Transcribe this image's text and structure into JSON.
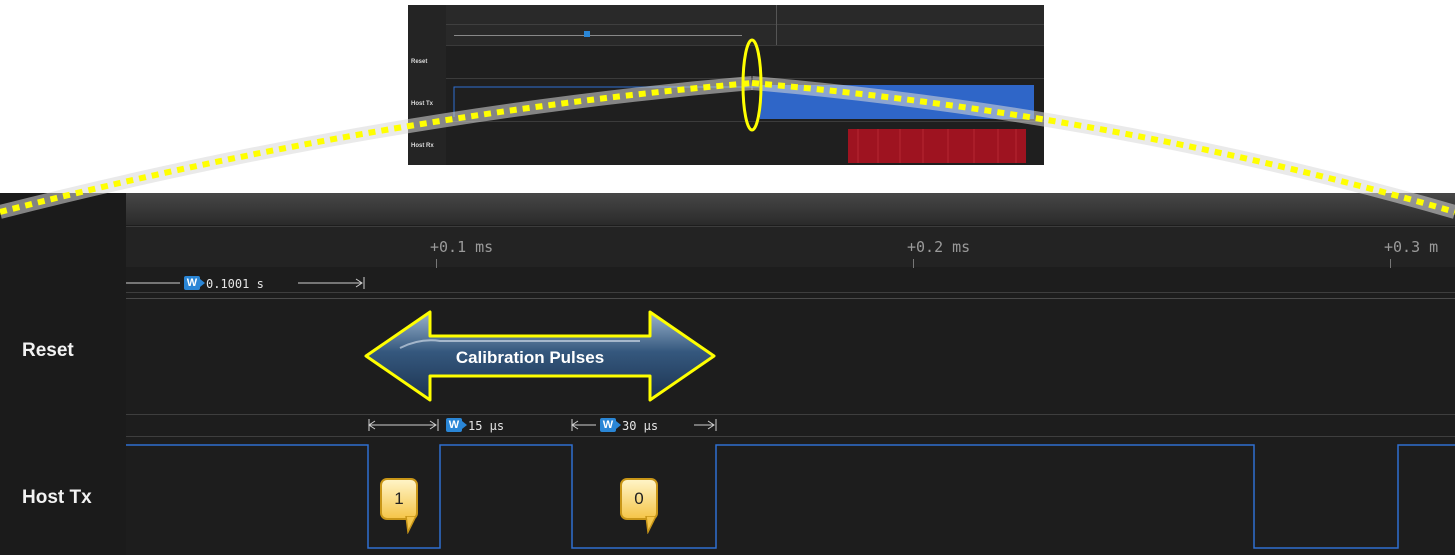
{
  "overview": {
    "channels": [
      {
        "label": "Reset"
      },
      {
        "label": "Host Tx"
      },
      {
        "label": "Host Rx"
      }
    ]
  },
  "main": {
    "time_ticks": [
      "+0.1 ms",
      "+0.2 ms",
      "+0.3 m"
    ],
    "channels": [
      {
        "label": "Reset"
      },
      {
        "label": "Host Tx"
      }
    ],
    "top_measurement": {
      "badge": "W",
      "value": "0.1001 s"
    },
    "measurements": [
      {
        "badge": "W",
        "value": "15 µs"
      },
      {
        "badge": "W",
        "value": "30 µs"
      }
    ],
    "annotation": {
      "label": "Calibration Pulses"
    },
    "bit_callouts": [
      "1",
      "0"
    ]
  },
  "colors": {
    "signal": "#2f6fd0",
    "highlight": "#ffff00",
    "badge": "#2a86d6",
    "rx_activity": "#b3141c"
  }
}
